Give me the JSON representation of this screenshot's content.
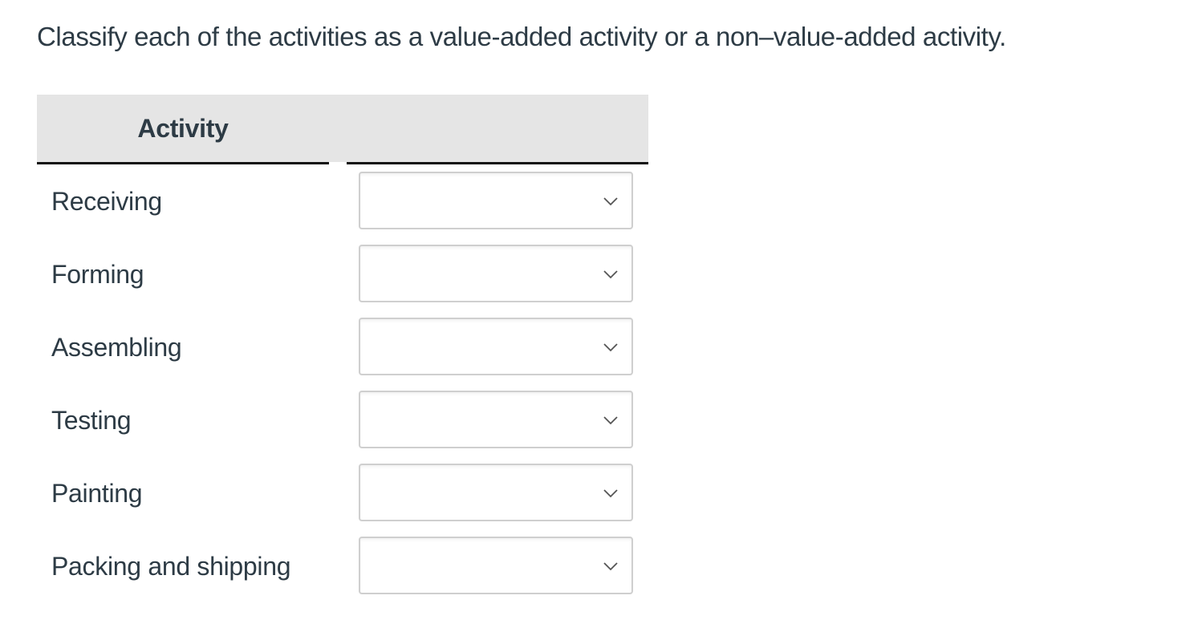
{
  "question": {
    "text": "Classify each of the activities as a value-added activity or a non–value-added activity."
  },
  "table": {
    "headers": {
      "activity": "Activity",
      "classification": ""
    },
    "rows": [
      {
        "activity": "Receiving",
        "selected": ""
      },
      {
        "activity": "Forming",
        "selected": ""
      },
      {
        "activity": "Assembling",
        "selected": ""
      },
      {
        "activity": "Testing",
        "selected": ""
      },
      {
        "activity": "Painting",
        "selected": ""
      },
      {
        "activity": "Packing and shipping",
        "selected": ""
      }
    ],
    "dropdown_icon": "chevron-down-icon"
  },
  "colors": {
    "text": "#2d3b45",
    "header_bg": "#e5e5e5",
    "rule": "#111111",
    "select_border": "#cfcfcf"
  }
}
